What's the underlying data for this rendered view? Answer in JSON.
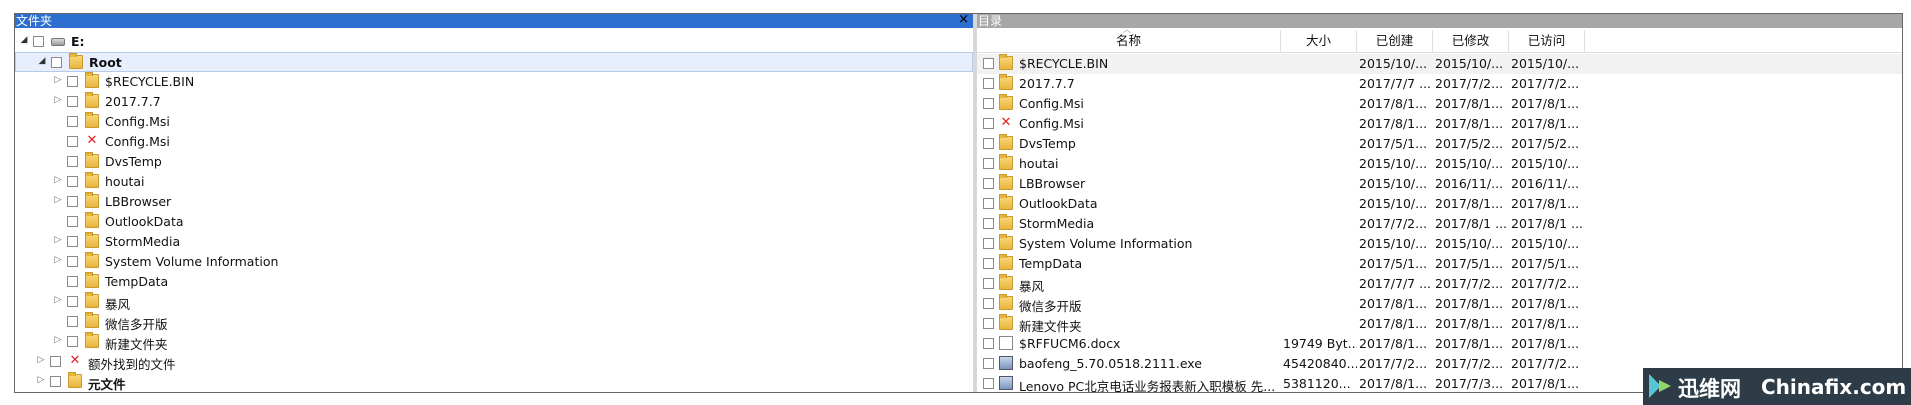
{
  "left": {
    "title": "文件夹",
    "close": "×",
    "tree": [
      {
        "indent": 0,
        "arrow": "◢",
        "check": true,
        "icon": "drive-icon",
        "label": "E:",
        "bold": true
      },
      {
        "indent": 1,
        "arrow": "◢",
        "check": true,
        "icon": "folder-icon",
        "label": "Root",
        "bold": true,
        "selected": true
      },
      {
        "indent": 2,
        "arrow": "▷",
        "check": true,
        "icon": "folder-icon",
        "label": "$RECYCLE.BIN"
      },
      {
        "indent": 2,
        "arrow": "▷",
        "check": true,
        "icon": "folder-icon",
        "label": "2017.7.7"
      },
      {
        "indent": 2,
        "arrow": "",
        "check": true,
        "icon": "folder-icon",
        "label": "Config.Msi"
      },
      {
        "indent": 2,
        "arrow": "",
        "check": true,
        "icon": "deleted-icon",
        "label": "Config.Msi"
      },
      {
        "indent": 2,
        "arrow": "",
        "check": true,
        "icon": "folder-icon",
        "label": "DvsTemp"
      },
      {
        "indent": 2,
        "arrow": "▷",
        "check": true,
        "icon": "folder-icon",
        "label": "houtai"
      },
      {
        "indent": 2,
        "arrow": "▷",
        "check": true,
        "icon": "folder-icon",
        "label": "LBBrowser"
      },
      {
        "indent": 2,
        "arrow": "",
        "check": true,
        "icon": "folder-icon",
        "label": "OutlookData"
      },
      {
        "indent": 2,
        "arrow": "▷",
        "check": true,
        "icon": "folder-icon",
        "label": "StormMedia"
      },
      {
        "indent": 2,
        "arrow": "▷",
        "check": true,
        "icon": "folder-icon",
        "label": "System Volume Information"
      },
      {
        "indent": 2,
        "arrow": "",
        "check": true,
        "icon": "folder-icon",
        "label": "TempData"
      },
      {
        "indent": 2,
        "arrow": "▷",
        "check": true,
        "icon": "folder-icon",
        "label": "暴风"
      },
      {
        "indent": 2,
        "arrow": "",
        "check": true,
        "icon": "folder-icon",
        "label": "微信多开版"
      },
      {
        "indent": 2,
        "arrow": "▷",
        "check": true,
        "icon": "folder-icon",
        "label": "新建文件夹"
      },
      {
        "indent": 1,
        "arrow": "▷",
        "check": true,
        "icon": "deleted-icon",
        "label": "额外找到的文件"
      },
      {
        "indent": 1,
        "arrow": "▷",
        "check": true,
        "icon": "folder-icon",
        "label": "元文件",
        "bold": true
      }
    ]
  },
  "right": {
    "title": "目录",
    "columns": [
      "名称",
      "大小",
      "已创建",
      "已修改",
      "已访问"
    ],
    "rows": [
      {
        "icon": "folder-icon",
        "name": "$RECYCLE.BIN",
        "size": "",
        "created": "2015/10/...",
        "modified": "2015/10/...",
        "accessed": "2015/10/...",
        "hover": true
      },
      {
        "icon": "folder-icon",
        "name": "2017.7.7",
        "size": "",
        "created": "2017/7/7 ...",
        "modified": "2017/7/2...",
        "accessed": "2017/7/2..."
      },
      {
        "icon": "folder-icon",
        "name": "Config.Msi",
        "size": "",
        "created": "2017/8/1...",
        "modified": "2017/8/1...",
        "accessed": "2017/8/1..."
      },
      {
        "icon": "deleted-icon",
        "name": "Config.Msi",
        "size": "",
        "created": "2017/8/1...",
        "modified": "2017/8/1...",
        "accessed": "2017/8/1..."
      },
      {
        "icon": "folder-icon",
        "name": "DvsTemp",
        "size": "",
        "created": "2017/5/1...",
        "modified": "2017/5/2...",
        "accessed": "2017/5/2..."
      },
      {
        "icon": "folder-icon",
        "name": "houtai",
        "size": "",
        "created": "2015/10/...",
        "modified": "2015/10/...",
        "accessed": "2015/10/..."
      },
      {
        "icon": "folder-icon",
        "name": "LBBrowser",
        "size": "",
        "created": "2015/10/...",
        "modified": "2016/11/...",
        "accessed": "2016/11/..."
      },
      {
        "icon": "folder-icon",
        "name": "OutlookData",
        "size": "",
        "created": "2015/10/...",
        "modified": "2017/8/1...",
        "accessed": "2017/8/1..."
      },
      {
        "icon": "folder-icon",
        "name": "StormMedia",
        "size": "",
        "created": "2017/7/2...",
        "modified": "2017/8/1 ...",
        "accessed": "2017/8/1 ..."
      },
      {
        "icon": "folder-icon",
        "name": "System Volume Information",
        "size": "",
        "created": "2015/10/...",
        "modified": "2015/10/...",
        "accessed": "2015/10/..."
      },
      {
        "icon": "folder-icon",
        "name": "TempData",
        "size": "",
        "created": "2017/5/1...",
        "modified": "2017/5/1...",
        "accessed": "2017/5/1..."
      },
      {
        "icon": "folder-icon",
        "name": "暴风",
        "size": "",
        "created": "2017/7/7 ...",
        "modified": "2017/7/2...",
        "accessed": "2017/7/2..."
      },
      {
        "icon": "folder-icon",
        "name": "微信多开版",
        "size": "",
        "created": "2017/8/1...",
        "modified": "2017/8/1...",
        "accessed": "2017/8/1..."
      },
      {
        "icon": "folder-icon",
        "name": "新建文件夹",
        "size": "",
        "created": "2017/8/1...",
        "modified": "2017/8/1...",
        "accessed": "2017/8/1..."
      },
      {
        "icon": "document-icon",
        "name": "$RFFUCM6.docx",
        "size": "19749 Byt...",
        "created": "2017/8/1...",
        "modified": "2017/8/1...",
        "accessed": "2017/8/1..."
      },
      {
        "icon": "exe-icon",
        "name": "baofeng_5.70.0518.2111.exe",
        "size": "45420840...",
        "created": "2017/7/2...",
        "modified": "2017/7/2...",
        "accessed": "2017/7/2..."
      },
      {
        "icon": "exe-icon",
        "name": "Lenovo PC北京电话业务报表新入职模板 先...",
        "size": "5381120...",
        "created": "2017/8/1...",
        "modified": "2017/7/3...",
        "accessed": "2017/8/1..."
      }
    ]
  },
  "watermark": {
    "cn": "迅维网",
    "en": "Chinafix.com"
  }
}
